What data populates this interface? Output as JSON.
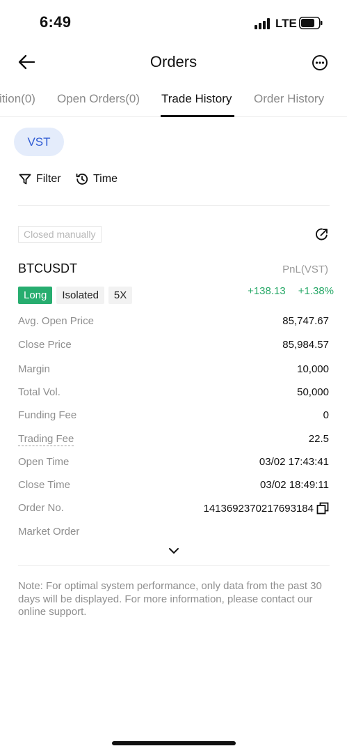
{
  "status_bar": {
    "time": "6:49",
    "network": "LTE"
  },
  "header": {
    "title": "Orders",
    "back_icon": "arrow-left-icon",
    "more_icon": "more-circle-icon"
  },
  "tabs": [
    {
      "label": "ition(0)"
    },
    {
      "label": "Open Orders(0)"
    },
    {
      "label": "Trade History"
    },
    {
      "label": "Order History"
    }
  ],
  "coin_chip": "VST",
  "filters": {
    "filter_label": "Filter",
    "time_label": "Time"
  },
  "card": {
    "status_tag": "Closed manually",
    "symbol": "BTCUSDT",
    "pnl_label": "PnL(VST)",
    "tags": {
      "side": "Long",
      "margin_mode": "Isolated",
      "leverage": "5X"
    },
    "pnl_value": "+138.13",
    "pnl_percent": "+1.38%",
    "rows": [
      {
        "label": "Avg. Open Price",
        "value": "85,747.67"
      },
      {
        "label": "Close Price",
        "value": "85,984.57"
      },
      {
        "label": "Margin",
        "value": "10,000"
      },
      {
        "label": "Total Vol.",
        "value": "50,000"
      },
      {
        "label": "Funding Fee",
        "value": "0"
      },
      {
        "label": "Trading Fee",
        "value": "22.5"
      },
      {
        "label": "Open Time",
        "value": "03/02 17:43:41"
      },
      {
        "label": "Close Time",
        "value": "03/02 18:49:11"
      }
    ],
    "order_no_label": "Order No.",
    "order_no": "1413692370217693184",
    "order_type": "Market Order"
  },
  "note": "Note: For optimal system performance, only data from the past 30 days will be displayed. For more information, please contact our online support.",
  "colors": {
    "accent_blue": "#2f5bd3",
    "chip_bg": "#e4ecfb",
    "profit_green": "#27a867",
    "long_green": "#27ad6f"
  }
}
